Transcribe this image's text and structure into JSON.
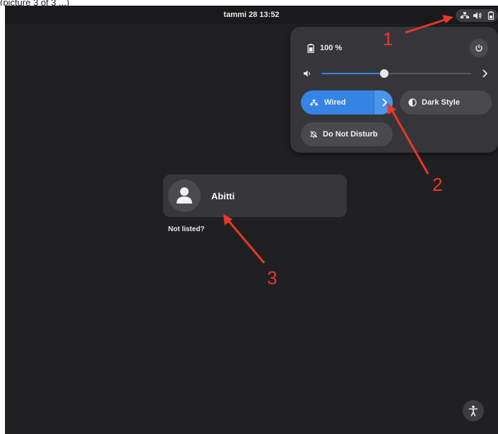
{
  "caption": "(picture 3 of 3 ...)",
  "topbar": {
    "clock": "tammi 28  13:52"
  },
  "quick_settings": {
    "battery_label": "100 %",
    "volume_level": 0.42,
    "tiles": {
      "wired": "Wired",
      "dark_style": "Dark Style",
      "dnd": "Do Not Disturb"
    }
  },
  "login": {
    "user_name": "Abitti",
    "not_listed": "Not listed?"
  },
  "annotations": [
    "1",
    "2",
    "3"
  ],
  "colors": {
    "accent": "#3584e4",
    "annotation": "#e8372b",
    "background": "#202022"
  },
  "icons": {
    "network": "network-wired-icon",
    "volume": "volume-icon",
    "battery": "battery-icon",
    "power": "power-icon",
    "dark_style": "dark-style-icon",
    "dnd": "bell-off-icon",
    "avatar": "user-avatar-icon",
    "accessibility": "accessibility-icon"
  }
}
